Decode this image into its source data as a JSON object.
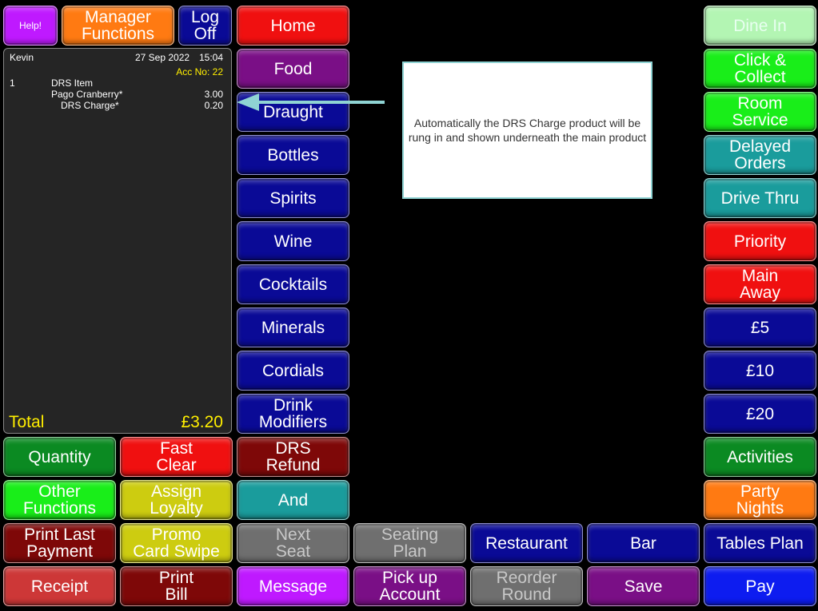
{
  "top": {
    "help": "Help!",
    "manager": "Manager\nFunctions",
    "logoff": "Log\nOff"
  },
  "receipt": {
    "user": "Kevin",
    "date": "27 Sep 2022",
    "time": "15:04",
    "account": "Acc No: 22",
    "lines": [
      {
        "qty": "1",
        "desc": "DRS Item",
        "price": ""
      },
      {
        "qty": "",
        "desc": "Pago Cranberry*",
        "price": "3.00"
      },
      {
        "qty": "",
        "desc": "DRS Charge*",
        "price": "0.20"
      }
    ],
    "total_label": "Total",
    "total_value": "£3.20"
  },
  "categories": [
    "Home",
    "Food",
    "Draught",
    "Bottles",
    "Spirits",
    "Wine",
    "Cocktails",
    "Minerals",
    "Cordials",
    "Drink\nModifiers"
  ],
  "right": [
    "Dine In",
    "Click &\nCollect",
    "Room\nService",
    "Delayed\nOrders",
    "Drive Thru",
    "Priority",
    "Main\nAway",
    "£5",
    "£10",
    "£20",
    "Activities",
    "Party\nNights",
    "Tables Plan",
    "Pay"
  ],
  "callout": "Automatically the DRS Charge product will be rung in and shown underneath the main product",
  "bottom": {
    "quantity": "Quantity",
    "fast_clear": "Fast\nClear",
    "drs_refund": "DRS\nRefund",
    "other_functions": "Other\nFunctions",
    "assign_loyalty": "Assign\nLoyalty",
    "and": "And",
    "print_last_payment": "Print Last\nPayment",
    "promo_card_swipe": "Promo\nCard Swipe",
    "next_seat": "Next\nSeat",
    "seating_plan": "Seating\nPlan",
    "restaurant": "Restaurant",
    "bar": "Bar",
    "receipt": "Receipt",
    "print_bill": "Print\nBill",
    "message": "Message",
    "pick_up_account": "Pick up\nAccount",
    "reorder_round": "Reorder\nRound",
    "save": "Save"
  },
  "colors": {
    "total_text": "#ffee00",
    "arrow": "#8fd3d3"
  }
}
